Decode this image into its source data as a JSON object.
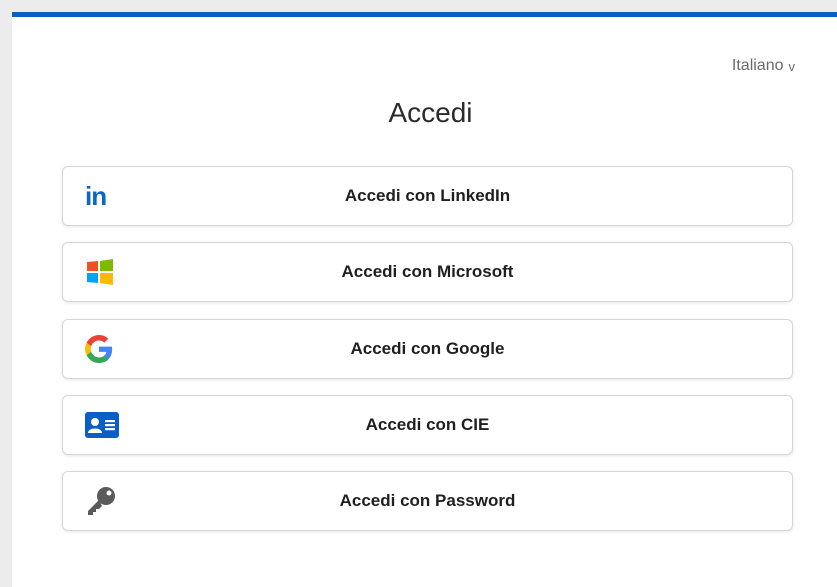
{
  "language_selector": {
    "label": "Italiano",
    "chevron": "v"
  },
  "page": {
    "title": "Accedi"
  },
  "login_options": [
    {
      "label": "Accedi con LinkedIn",
      "icon": "linkedin-icon"
    },
    {
      "label": "Accedi con Microsoft",
      "icon": "microsoft-icon"
    },
    {
      "label": "Accedi con Google",
      "icon": "google-icon"
    },
    {
      "label": "Accedi con CIE",
      "icon": "cie-id-card-icon"
    },
    {
      "label": "Accedi con Password",
      "icon": "key-icon"
    }
  ],
  "colors": {
    "top_bar": "#0a5fc7",
    "linkedin": "#0a66c2",
    "cie": "#0a5fc7",
    "key": "#5a5a5a"
  }
}
